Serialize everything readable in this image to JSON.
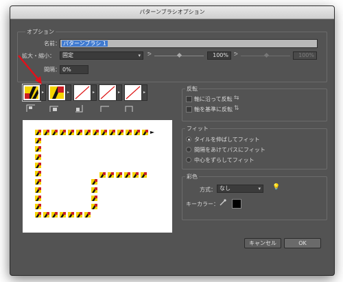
{
  "window": {
    "title": "パターンブラシオプション"
  },
  "options": {
    "group_label": "オプション",
    "name_label": "名前：",
    "name_value": "パターンブラシ 1",
    "scale_label": "拡大・縮小：",
    "scale_mode": "固定",
    "scale_value": "100%",
    "scale_value2": "100%",
    "spacing_label": "間隔：",
    "spacing_value": "0%"
  },
  "flip": {
    "group_label": "反転",
    "along_label": "軸に沿って反転",
    "across_label": "軸を基準に反転"
  },
  "fit": {
    "group_label": "フィット",
    "options": [
      "タイルを伸ばしてフィット",
      "間隔をあけてパスにフィット",
      "中心をずらしてフィット"
    ],
    "selected_index": 0
  },
  "color": {
    "group_label": "彩色",
    "method_label": "方式：",
    "method_value": "なし",
    "key_color_label": "キーカラー：",
    "key_color": "#000000"
  },
  "buttons": {
    "cancel": "キャンセル",
    "ok": "OK"
  },
  "icons": {
    "tile_pattern": "hazard-stripe-tile-icon",
    "tile_none": "no-tile-icon",
    "annotation": "red-arrow-annotation-icon",
    "eyedropper": "eyedropper-icon",
    "tip": "lightbulb-icon"
  },
  "colors": {
    "dialog_bg": "#535353",
    "stripe_yellow": "#f5d400",
    "stripe_black": "#111111",
    "tile_red": "#cc1e22",
    "annotation_red": "#e3101a"
  }
}
